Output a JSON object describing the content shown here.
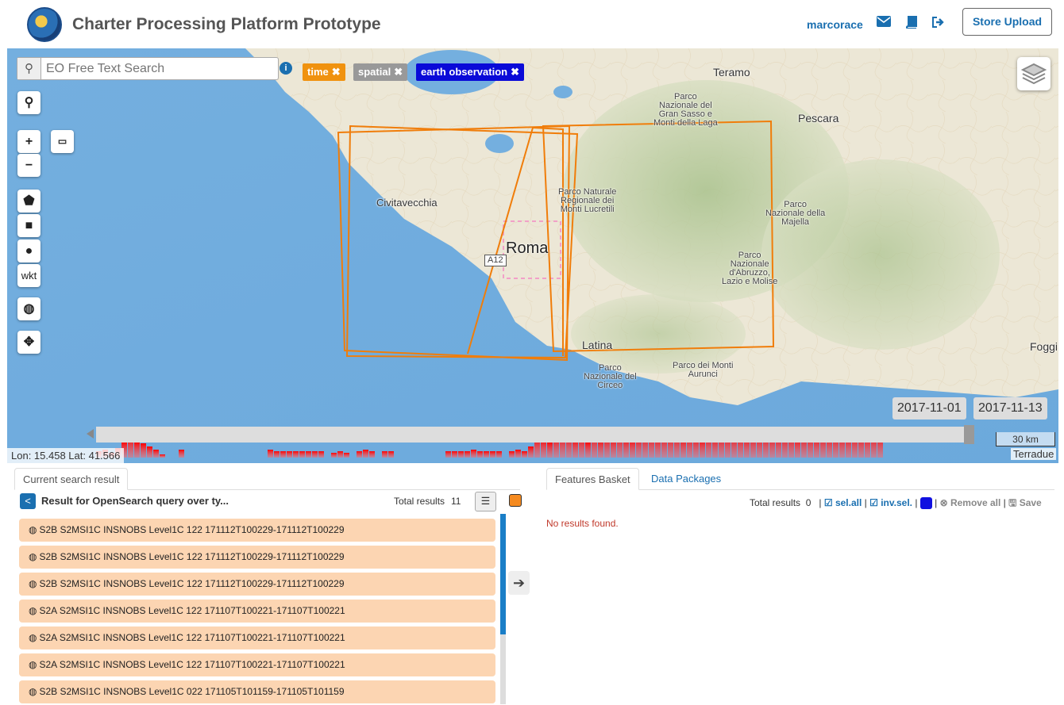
{
  "header": {
    "title": "Charter Processing Platform Prototype",
    "user": "marcorace",
    "store_upload": "Store Upload",
    "icons": [
      "envelope-icon",
      "book-icon",
      "sign-out-icon"
    ]
  },
  "map": {
    "search_placeholder": "EO Free Text Search",
    "chips": [
      {
        "label": "time",
        "color": "#f0920f"
      },
      {
        "label": "spatial",
        "color": "#999999"
      },
      {
        "label": "earth observation",
        "color": "#0a0ad8"
      }
    ],
    "controls": {
      "zoom_in": "+",
      "zoom_out": "−",
      "wkt": "wkt"
    },
    "places": {
      "teramo": "Teramo",
      "pescara": "Pescara",
      "gran_sasso": "Parco\nNazionale del\nGran Sasso e\nMonti della Laga",
      "civitavecchia": "Civitavecchia",
      "lucretili": "Parco Naturale\nRegionale dei\nMonti Lucretili",
      "majella": "Parco\nNazionale della\nMajella",
      "roma": "Roma",
      "a12": "A12",
      "abruzzo": "Parco\nNazionale\nd'Abruzzo,\nLazio e Molise",
      "latina": "Latina",
      "foggia": "Foggi",
      "circeo": "Parco\nNazionale del\nCirceo",
      "aurunci": "Parco dei Monti\nAurunci"
    },
    "date_start": "2017-11-01",
    "date_end": "2017-11-13",
    "coords": "Lon: 15.458 Lat: 41.566",
    "scale": "30 km",
    "attribution": "Terradue"
  },
  "left": {
    "tab": "Current search result",
    "result_title": "Result for OpenSearch query over ty...",
    "total_label": "Total results",
    "total_value": "11",
    "swatch_color": "#f58a1f",
    "rows": [
      "S2B S2MSI1C INSNOBS Level1C 122 171112T100229-171112T100229",
      "S2B S2MSI1C INSNOBS Level1C 122 171112T100229-171112T100229",
      "S2B S2MSI1C INSNOBS Level1C 122 171112T100229-171112T100229",
      "S2A S2MSI1C INSNOBS Level1C 122 171107T100221-171107T100221",
      "S2A S2MSI1C INSNOBS Level1C 122 171107T100221-171107T100221",
      "S2A S2MSI1C INSNOBS Level1C 122 171107T100221-171107T100221",
      "S2B S2MSI1C INSNOBS Level1C 022 171105T101159-171105T101159"
    ]
  },
  "right": {
    "tab_basket": "Features Basket",
    "tab_packages": "Data Packages",
    "total_label": "Total results",
    "total_value": "0",
    "sel_all": "sel.all",
    "inv_sel": "inv.sel.",
    "remove_all": "Remove all",
    "save": "Save",
    "swatch_color": "#1010e0",
    "no_results": "No results found."
  }
}
